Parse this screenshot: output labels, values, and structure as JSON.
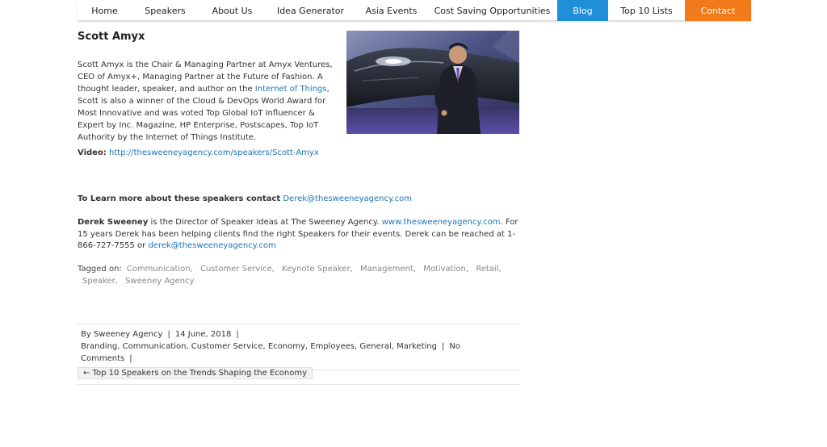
{
  "nav": {
    "items": [
      {
        "label": "Home"
      },
      {
        "label": "Speakers"
      },
      {
        "label": "About Us"
      },
      {
        "label": "Idea Generator"
      },
      {
        "label": "Asia Events"
      },
      {
        "label": "Cost Saving Opportunities"
      },
      {
        "label": "Blog"
      },
      {
        "label": "Top 10 Lists"
      },
      {
        "label": "Contact"
      }
    ],
    "colors": {
      "blog": "#1e8fd8",
      "contact": "#f27a1a"
    }
  },
  "article": {
    "title": "Scott Amyx",
    "bio_part1": "Scott Amyx is the Chair & Managing Partner at Amyx Ventures, CEO of Amyx+, Managing Partner at the Future of Fashion. A thought leader, speaker, and author on the ",
    "bio_link": "Internet of Things",
    "bio_part2": ", Scott is also a winner of the Cloud & DevOps World Award for Most Innovative and was voted Top Global IoT Influencer & Expert by Inc. Magazine, HP Enterprise, Postscapes, Top IoT Authority by the Internet of Things Institute.",
    "video_label": "Video:",
    "video_link": "http://thesweeneyagency.com/speakers/Scott-Amyx",
    "contact_label": "To Learn more about these speakers contact",
    "contact_email": "Derek@thesweeneyagency.com",
    "derek_name": "Derek Sweeney",
    "derek_text1": " is the Director of Speaker Ideas at The Sweeney Agency. ",
    "derek_site": "www.thesweeneyagency.com",
    "derek_text2": ". For 15 years Derek has been helping clients find the right Speakers for their events. Derek can be reached at 1-866-727-7555 or ",
    "derek_email": "derek@thesweeneyagency.com"
  },
  "tags": {
    "label": "Tagged on:",
    "items": [
      "Communication,",
      "Customer Service,",
      "Keynote Speaker,",
      "Management,",
      "Motivation,",
      "Retail,",
      "Speaker,",
      "Sweeney Agency"
    ]
  },
  "meta": {
    "by": "By Sweeney Agency",
    "sep": "|",
    "date": "14 June, 2018",
    "categories": "Branding, Communication, Customer Service, Economy, Employees, General, Marketing",
    "comments": "No Comments"
  },
  "prev_post": {
    "label": "← Top 10 Speakers on the Trends Shaping the Economy"
  }
}
